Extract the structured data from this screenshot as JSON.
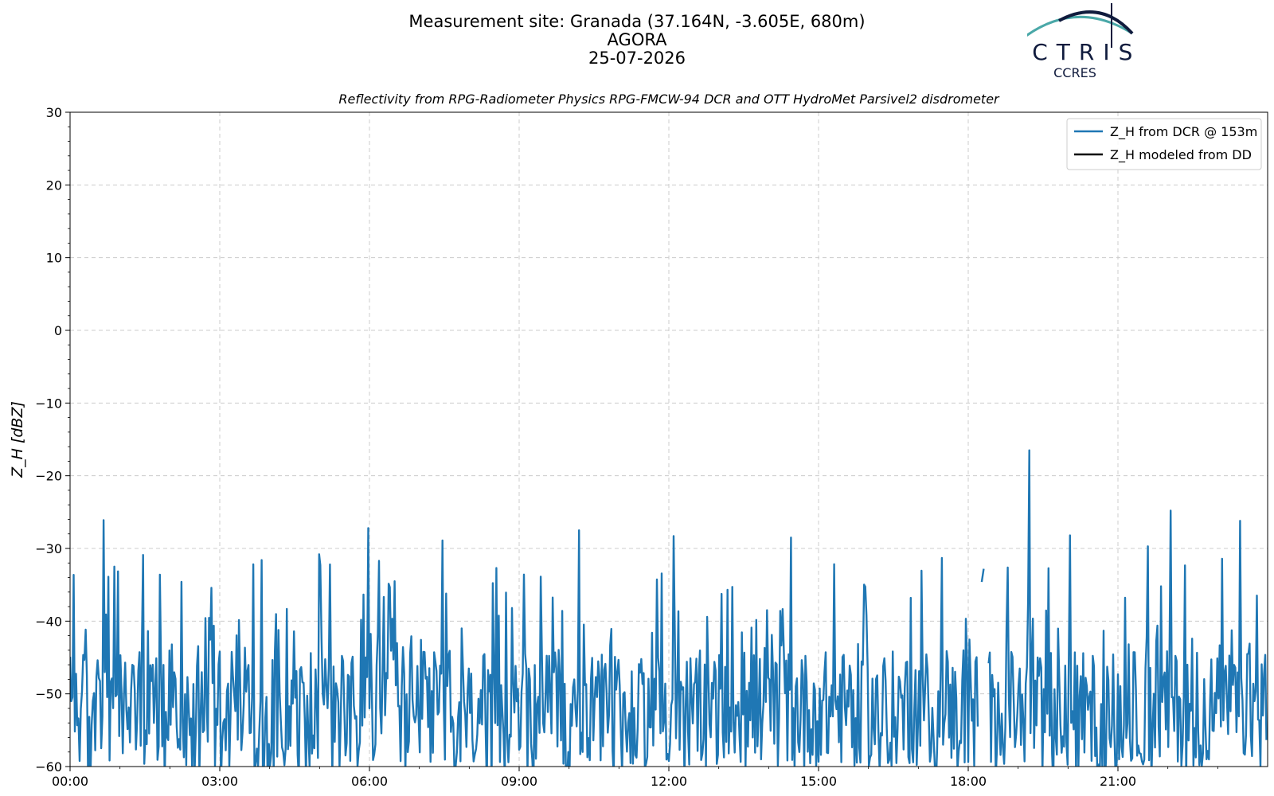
{
  "header": {
    "line1": "Measurement site: Granada (37.164N, -3.605E, 680m)",
    "line2": "AGORA",
    "line3": "25-07-2026"
  },
  "logo": {
    "name": "ACTRIS",
    "sub": "CCRES"
  },
  "colors": {
    "series": "#1f77b4",
    "model": "#000000",
    "grid": "#cccccc",
    "logo_dark": "#101b3d",
    "logo_teal": "#4aa8a8"
  },
  "chart_data": {
    "type": "line",
    "title": "Reflectivity from RPG-Radiometer Physics RPG-FMCW-94 DCR and OTT HydroMet Parsivel2 disdrometer",
    "ylabel": "Z_H [dBZ]",
    "ylim": [
      -60,
      30
    ],
    "xlim_hours": [
      0,
      24
    ],
    "yticks": [
      30,
      20,
      10,
      0,
      -10,
      -20,
      -30,
      -40,
      -50,
      -60
    ],
    "ytick_labels": [
      "30",
      "20",
      "10",
      "0",
      "−10",
      "−20",
      "−30",
      "−40",
      "−50",
      "−60"
    ],
    "xticks": [
      "00:00",
      "03:00",
      "06:00",
      "09:00",
      "12:00",
      "15:00",
      "18:00",
      "21:00"
    ],
    "grid": true,
    "legend_position": "top-right",
    "series": [
      {
        "name": "Z_H from DCR @ 153m",
        "peaks": [
          {
            "x": 0.68,
            "y": -26.1
          },
          {
            "x": 0.9,
            "y": -32.5
          },
          {
            "x": 1.47,
            "y": -30.9
          },
          {
            "x": 1.8,
            "y": -33.6
          },
          {
            "x": 3.85,
            "y": -31.6
          },
          {
            "x": 5.0,
            "y": -30.8
          },
          {
            "x": 5.97,
            "y": -27.2
          },
          {
            "x": 7.47,
            "y": -28.9
          },
          {
            "x": 10.2,
            "y": -27.5
          },
          {
            "x": 12.1,
            "y": -28.3
          },
          {
            "x": 14.45,
            "y": -28.5
          },
          {
            "x": 17.47,
            "y": -31.3
          },
          {
            "x": 19.22,
            "y": -16.5
          },
          {
            "x": 20.05,
            "y": -28.2
          },
          {
            "x": 21.6,
            "y": -29.7
          },
          {
            "x": 22.05,
            "y": -24.8
          },
          {
            "x": 23.45,
            "y": -26.2
          }
        ],
        "segments": [
          {
            "x": [
              18.27,
              18.31
            ],
            "y": [
              -34.6,
              -32.8
            ]
          }
        ]
      },
      {
        "name": "Z_H modeled from DD",
        "values": []
      }
    ]
  }
}
